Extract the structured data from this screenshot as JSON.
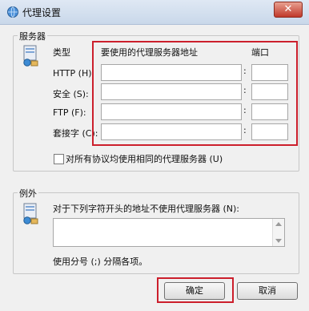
{
  "window": {
    "title": "代理设置",
    "close_label": "✕"
  },
  "servers": {
    "group_label": "服务器",
    "col_type": "类型",
    "col_address": "要使用的代理服务器地址",
    "col_port": "端口",
    "rows": [
      {
        "type": "HTTP (H):",
        "address": "",
        "port": ""
      },
      {
        "type": "安全 (S):",
        "address": "",
        "port": ""
      },
      {
        "type": "FTP (F):",
        "address": "",
        "port": ""
      },
      {
        "type": "套接字 (C):",
        "address": "",
        "port": ""
      }
    ],
    "same_proxy_label": "对所有协议均使用相同的代理服务器 (U)",
    "same_proxy_checked": false
  },
  "exceptions": {
    "group_label": "例外",
    "description": "对于下列字符开头的地址不使用代理服务器 (N):",
    "value": "",
    "hint": "使用分号 (;) 分隔各项。"
  },
  "buttons": {
    "ok": "确定",
    "cancel": "取消"
  },
  "colors": {
    "highlight": "#cc1f2c"
  }
}
